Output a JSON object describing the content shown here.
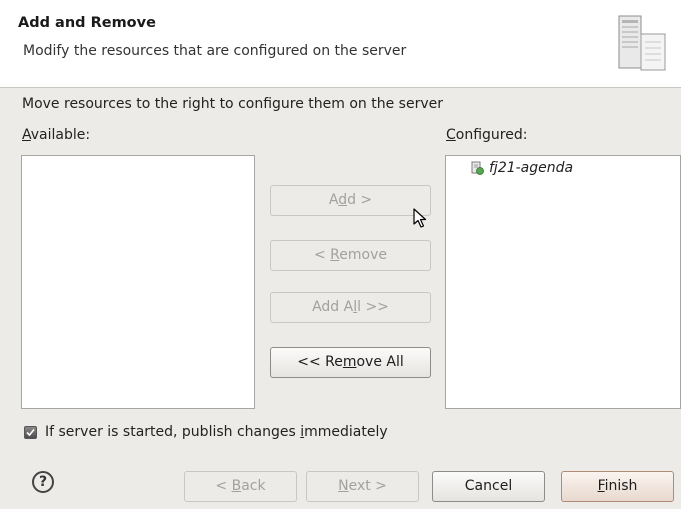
{
  "header": {
    "title": "Add and Remove",
    "description": "Modify the resources that are configured on the server"
  },
  "instructions": "Move resources to the right to configure them on the server",
  "available": {
    "label_mnemonic": "A",
    "label_rest": "vailable:"
  },
  "configured": {
    "label_mnemonic": "C",
    "label_rest": "onfigured:",
    "items": [
      {
        "label": "fj21-agenda"
      }
    ]
  },
  "buttons": {
    "add": {
      "pre": "A",
      "mn": "d",
      "post": "d >"
    },
    "remove": {
      "pre": "< ",
      "mn": "R",
      "post": "emove"
    },
    "add_all": {
      "pre": "Add A",
      "mn": "l",
      "post": "l >>"
    },
    "remove_all": {
      "pre": "<< Re",
      "mn": "m",
      "post": "ove All"
    }
  },
  "publish_checkbox": {
    "checked": true,
    "pre": "If server is started, publish changes ",
    "mn": "i",
    "post": "mmediately"
  },
  "footer": {
    "help": "?",
    "back": {
      "pre": "< ",
      "mn": "B",
      "post": "ack"
    },
    "next": {
      "pre": "",
      "mn": "N",
      "post": "ext >"
    },
    "cancel": "Cancel",
    "finish": {
      "pre": "",
      "mn": "F",
      "post": "inish"
    }
  }
}
